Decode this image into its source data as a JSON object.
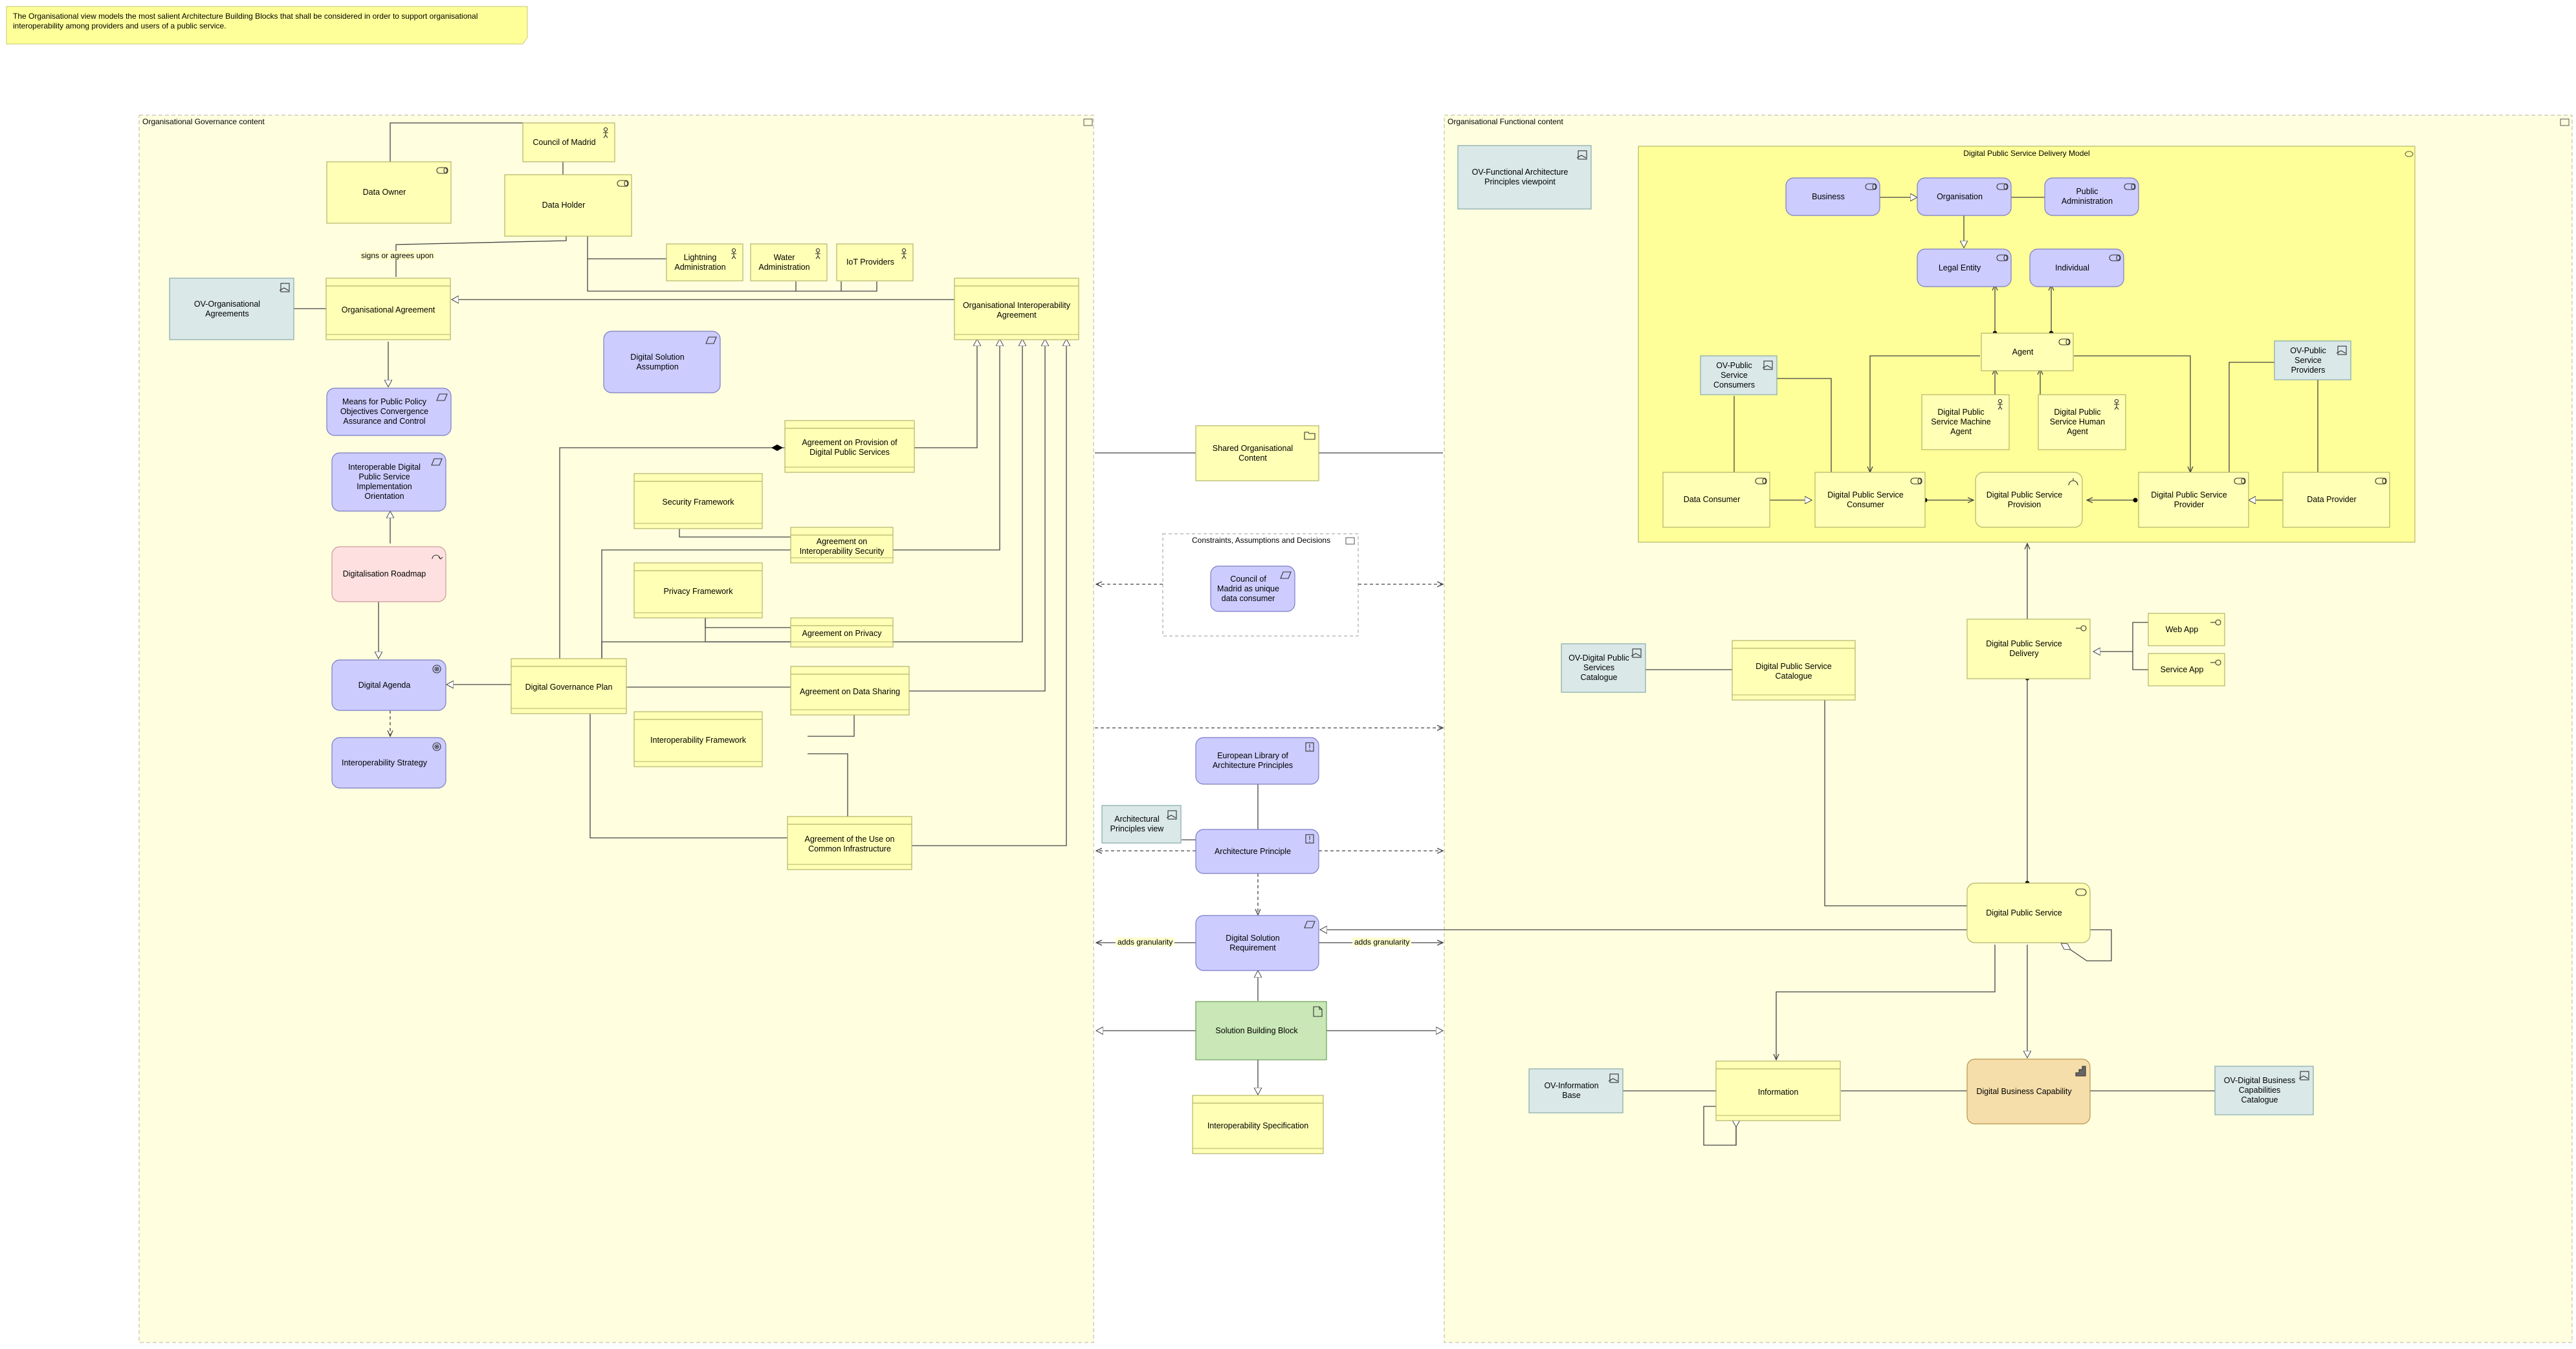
{
  "note": "The Organisational view models the most salient Architecture Building Blocks that shall be considered in order to support organisational interoperability among providers and users of a public service.",
  "groups": {
    "governance": "Organisational Governance content",
    "functional": "Organisational Functional content",
    "constraints": "Constraints, Assumptions and Decisions",
    "delivery_model": "Digital Public Service Delivery Model"
  },
  "nodes": {
    "council_of_madrid": "Council of Madrid",
    "data_owner": "Data Owner",
    "data_holder": "Data Holder",
    "lightning_admin": "Lightning Administration",
    "water_admin": "Water Administration",
    "iot_providers": "IoT Providers",
    "ov_org_agreements": "OV-Organisational Agreements",
    "org_agreement": "Organisational Agreement",
    "org_interop_agreement": "Organisational Interoperability Agreement",
    "means_public_policy": "Means for Public Policy Objectives Convergence Assurance and Control",
    "digital_solution_assumption": "Digital Solution Assumption",
    "interop_digital_ps_impl": "Interoperable Digital Public Service Implementation Orientation",
    "digitalisation_roadmap": "Digitalisation Roadmap",
    "digital_agenda": "Digital Agenda",
    "interop_strategy": "Interoperability Strategy",
    "agreement_provision": "Agreement on Provision of Digital Public Services",
    "security_framework": "Security Framework",
    "agreement_interop_security": "Agreement on Interoperability Security",
    "privacy_framework": "Privacy Framework",
    "agreement_privacy": "Agreement on Privacy",
    "digital_governance_plan": "Digital Governance Plan",
    "agreement_data_sharing": "Agreement on Data Sharing",
    "interop_framework": "Interoperability Framework",
    "agreement_common_infra": "Agreement of the Use on Common Infrastructure",
    "shared_org_content": "Shared Organisational Content",
    "council_unique_consumer": "Council of Madrid as unique data consumer",
    "european_library": "European Library of Architecture Principles",
    "arch_principles_view": "Architectural Principles view",
    "architecture_principle": "Architecture Principle",
    "digital_solution_requirement": "Digital Solution Requirement",
    "solution_building_block": "Solution Building Block",
    "interop_specification": "Interoperability Specification",
    "ov_functional_viewpoint": "OV-Functional Architecture Principles viewpoint",
    "business": "Business",
    "organisation": "Organisation",
    "public_administration": "Public Administration",
    "legal_entity": "Legal Entity",
    "individual": "Individual",
    "agent": "Agent",
    "ov_ps_consumers": "OV-Public Service Consumers",
    "ov_ps_providers": "OV-Public Service Providers",
    "dps_machine_agent": "Digital Public Service Machine Agent",
    "dps_human_agent": "Digital Public Service Human Agent",
    "data_consumer": "Data Consumer",
    "dps_consumer": "Digital Public Service Consumer",
    "dps_provision": "Digital Public Service Provision",
    "dps_provider": "Digital Public Service Provider",
    "data_provider": "Data Provider",
    "dps_delivery": "Digital Public Service Delivery",
    "web_app": "Web App",
    "service_app": "Service App",
    "ov_dps_catalogue": "OV-Digital Public Services Catalogue",
    "dps_catalogue": "Digital Public Service Catalogue",
    "digital_public_service": "Digital Public Service",
    "ov_info_base": "OV-Information Base",
    "information": "Information",
    "digital_business_capability": "Digital Business Capability",
    "ov_dbc_catalogue": "OV-Digital Business Capabilities Catalogue"
  },
  "edge_labels": {
    "signs_or_agrees": "signs or agrees upon",
    "adds_granularity_left": "adds granularity",
    "adds_granularity_right": "adds granularity"
  },
  "colors": {
    "business_yellow": "#ffffb5",
    "motivation_purple": "#ccccff",
    "view_blue": "#dae8e8",
    "roadmap_pink": "#ffe0e0",
    "sbb_green": "#c9e7b7",
    "capability_orange": "#f5deaa",
    "group_fill": "#ffffe0",
    "note_yellow": "#ffff99"
  }
}
